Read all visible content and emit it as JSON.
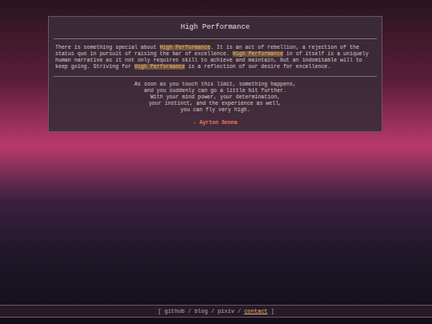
{
  "page": {
    "title": "High Performance",
    "paragraph": [
      {
        "text": "There is something special about ",
        "highlight": false
      },
      {
        "text": "High Performance",
        "highlight": true
      },
      {
        "text": ". It is an act of rebellion, a rejection of the status quo in pursuit of raising the bar of excellence. ",
        "highlight": false
      },
      {
        "text": "High Performance",
        "highlight": true
      },
      {
        "text": " in of itself is a uniquely human narrative as it not only requires skill to achieve and maintain, but an indomitable will to keep going. Striving for ",
        "highlight": false
      },
      {
        "text": "High Performance",
        "highlight": true
      },
      {
        "text": " is a reflection of our desire for excellence.",
        "highlight": false
      }
    ],
    "quote": [
      "As soon as you touch this limit, something happens,",
      "and you suddenly can go a little bit further.",
      "With your mind power, your determination,",
      "your instinct, and the experience as well,",
      "you can fly very high."
    ],
    "attribution": "- Ayrton Senna"
  },
  "nav": {
    "open": "[",
    "close": "]",
    "separator": "/",
    "links": [
      {
        "label": "github",
        "selected": false
      },
      {
        "label": "blog",
        "selected": false
      },
      {
        "label": "pixiv",
        "selected": false
      },
      {
        "label": "contact",
        "selected": true
      }
    ]
  }
}
